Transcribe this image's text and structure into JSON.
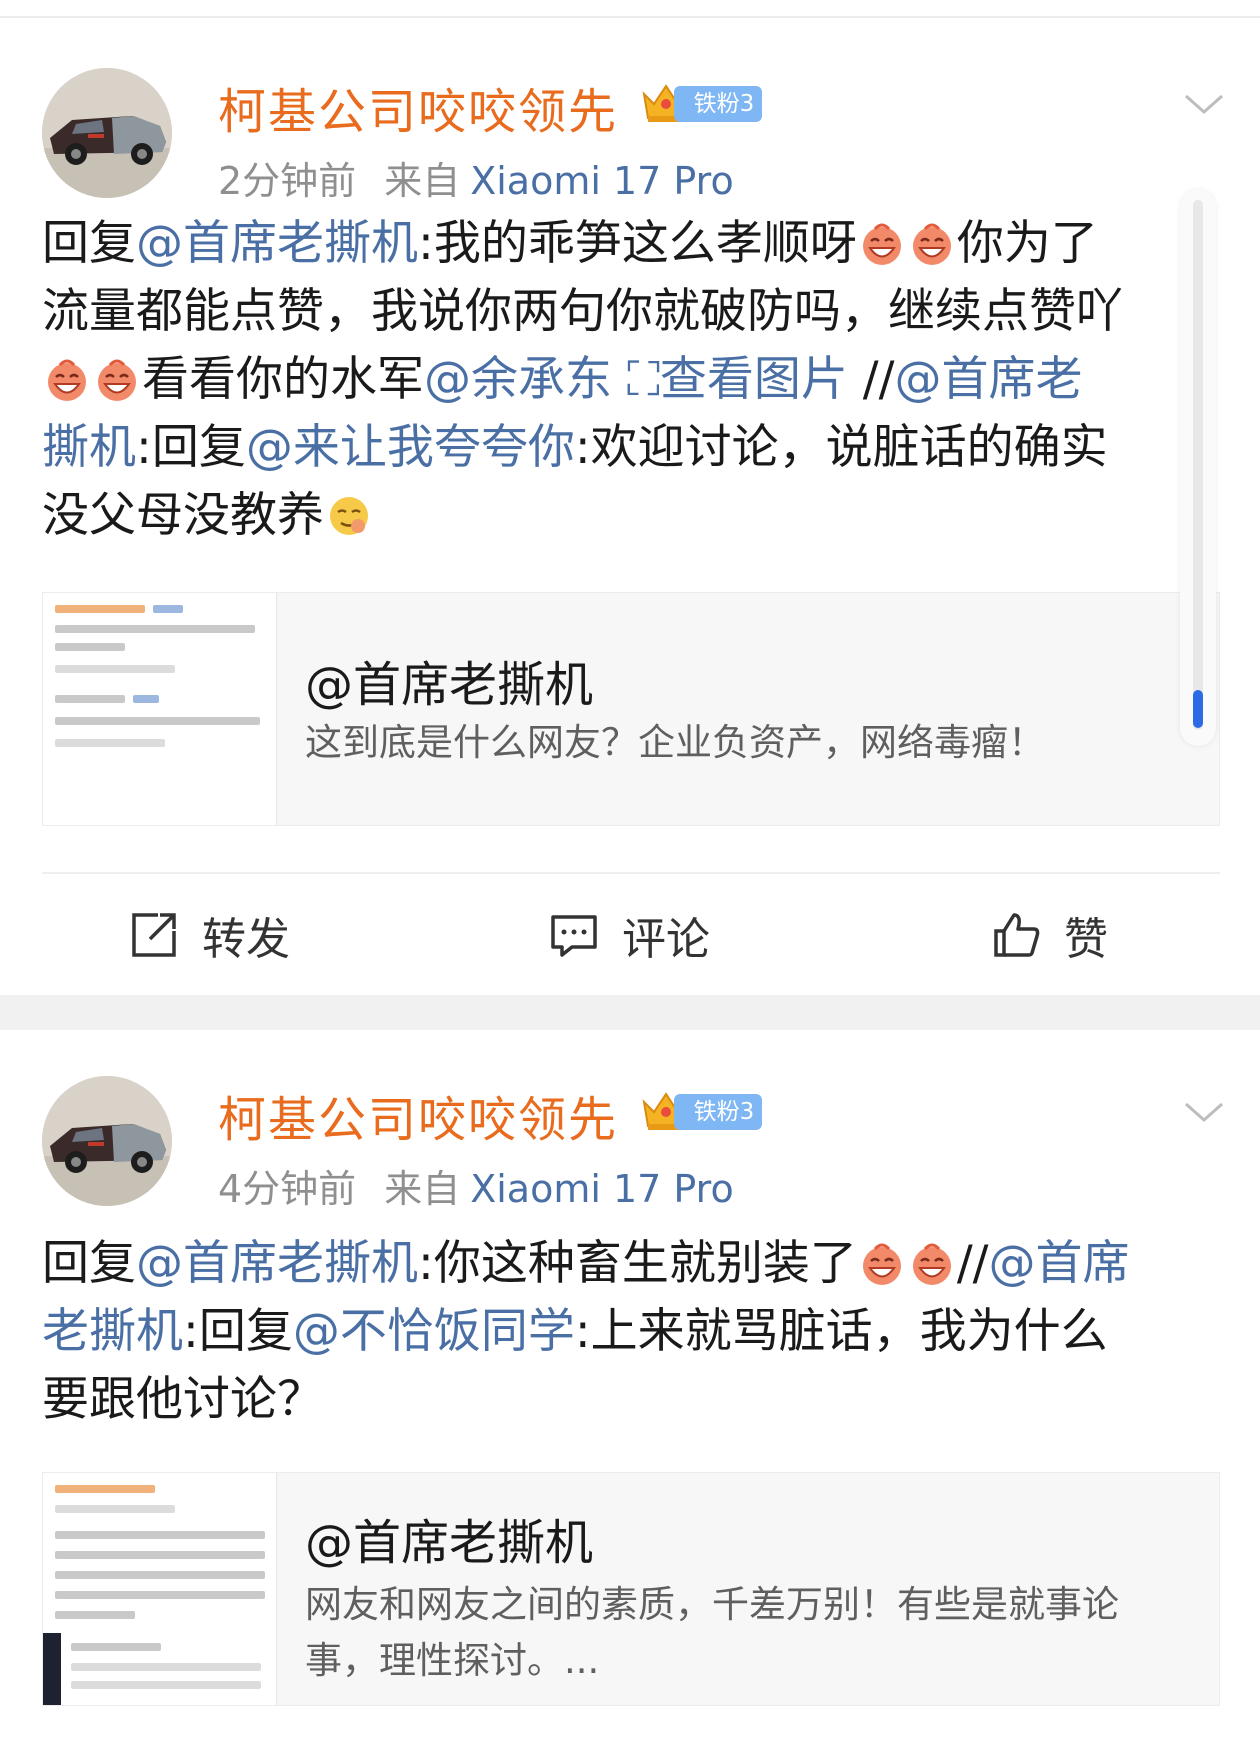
{
  "posts": [
    {
      "username": "柯基公司咬咬领先",
      "badge": "铁粉3",
      "time": "2分钟前",
      "source_label": "来自",
      "device": "Xiaomi 17 Pro",
      "lines": [
        [
          {
            "t": "回复"
          },
          {
            "m": "@首席老撕机"
          },
          {
            "t": ":我的乖笋这么孝顺呀"
          },
          {
            "e": "laugh-emoji"
          },
          {
            "e": "laugh-emoji"
          },
          {
            "t": "你为了"
          }
        ],
        [
          {
            "t": "流量都能点赞，我说你两句你就破防吗，继续点赞吖"
          }
        ],
        [
          {
            "e": "laugh-emoji"
          },
          {
            "e": "laugh-emoji"
          },
          {
            "t": "看看你的水军"
          },
          {
            "m": "@余承东"
          },
          {
            "t": " "
          },
          {
            "m": "⛶查看图片"
          },
          {
            "t": " //"
          },
          {
            "m": "@首席老"
          }
        ],
        [
          {
            "m": "撕机"
          },
          {
            "t": ":回复"
          },
          {
            "m": "@来让我夸夸你"
          },
          {
            "t": ":欢迎讨论，说脏话的确实"
          }
        ],
        [
          {
            "t": "没父母没教养"
          },
          {
            "e": "smirk-emoji"
          }
        ]
      ],
      "quote": {
        "title": "@首席老撕机",
        "body": [
          "这到底是什么网友？企业负资产，网络毒瘤！"
        ]
      },
      "actions": {
        "repost": "转发",
        "comment": "评论",
        "like": "赞"
      }
    },
    {
      "username": "柯基公司咬咬领先",
      "badge": "铁粉3",
      "time": "4分钟前",
      "source_label": "来自",
      "device": "Xiaomi 17 Pro",
      "lines": [
        [
          {
            "t": "回复"
          },
          {
            "m": "@首席老撕机"
          },
          {
            "t": ":你这种畜生就别装了"
          },
          {
            "e": "laugh-emoji"
          },
          {
            "e": "laugh-emoji"
          },
          {
            "t": "//"
          },
          {
            "m": "@首席"
          }
        ],
        [
          {
            "m": "老撕机"
          },
          {
            "t": ":回复"
          },
          {
            "m": "@不恰饭同学"
          },
          {
            "t": ":上来就骂脏话，我为什么"
          }
        ],
        [
          {
            "t": "要跟他讨论？"
          }
        ]
      ],
      "quote": {
        "title": "@首席老撕机",
        "body": [
          "网友和网友之间的素质，千差万别！有些是就事论",
          "事，理性探讨。..."
        ]
      }
    }
  ],
  "colors": {
    "username": "#e86b1e",
    "mention": "#4a6fa5",
    "badge": "#7fb6f4",
    "scroll_thumb": "#2d6be5"
  }
}
